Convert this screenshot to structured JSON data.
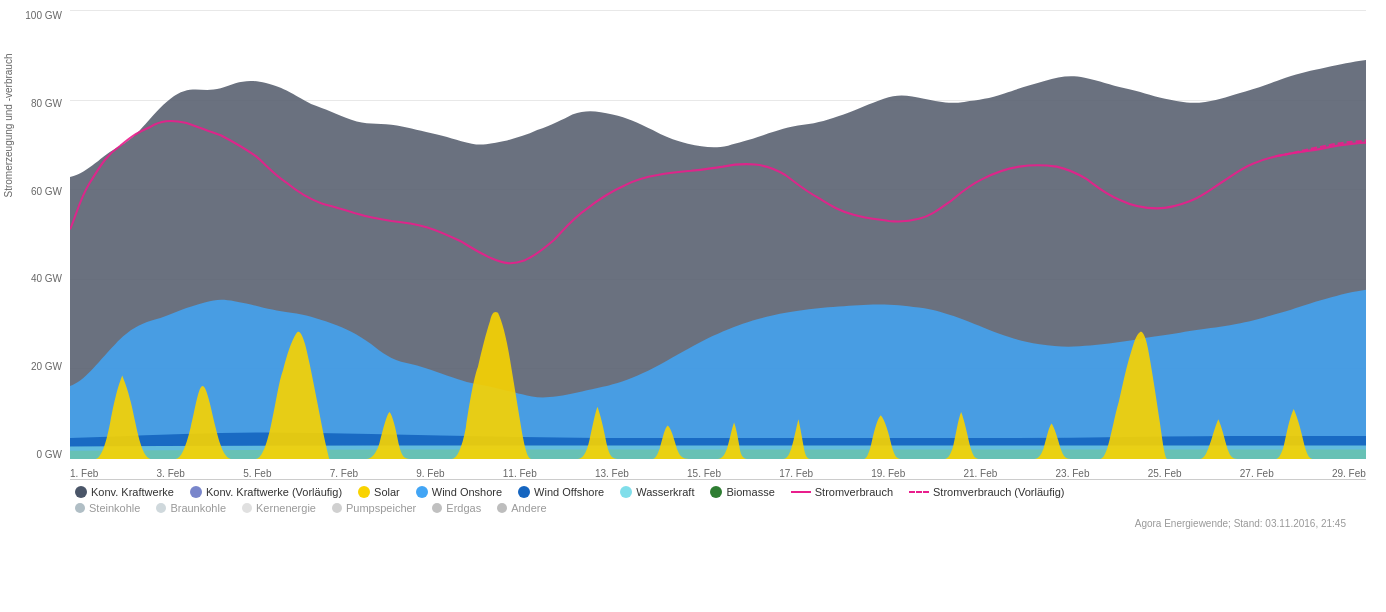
{
  "chart": {
    "title": "Stromerzeugung und -verbrauch",
    "y_axis": {
      "label": "Stromerzeugung und -verbrauch",
      "ticks": [
        "100 GW",
        "80 GW",
        "60 GW",
        "40 GW",
        "20 GW",
        "0 GW"
      ]
    },
    "x_axis": {
      "ticks": [
        "1. Feb",
        "3. Feb",
        "5. Feb",
        "7. Feb",
        "9. Feb",
        "11. Feb",
        "13. Feb",
        "15. Feb",
        "17. Feb",
        "19. Feb",
        "21. Feb",
        "23. Feb",
        "25. Feb",
        "27. Feb",
        "29. Feb"
      ]
    }
  },
  "legend": {
    "row1": [
      {
        "type": "dot",
        "color": "#4a5568",
        "label": "Konv. Kraftwerke"
      },
      {
        "type": "dot",
        "color": "#7986cb",
        "label": "Konv. Kraftwerke (Vorläufig)"
      },
      {
        "type": "dot",
        "color": "#f9d300",
        "label": "Solar"
      },
      {
        "type": "dot",
        "color": "#42a5f5",
        "label": "Wind Onshore"
      },
      {
        "type": "dot",
        "color": "#1565c0",
        "label": "Wind Offshore"
      },
      {
        "type": "dot",
        "color": "#80deea",
        "label": "Wasserkraft"
      },
      {
        "type": "dot",
        "color": "#2e7d32",
        "label": "Biomasse"
      },
      {
        "type": "line",
        "color": "#e91e8c",
        "dashed": false,
        "label": "Stromverbrauch"
      },
      {
        "type": "line",
        "color": "#e91e8c",
        "dashed": true,
        "label": "Stromverbrauch (Vorläufig)"
      }
    ],
    "row2": [
      {
        "type": "dot",
        "color": "#b0bec5",
        "label": "Steinkohle"
      },
      {
        "type": "dot",
        "color": "#cfd8dc",
        "label": "Braunkohle"
      },
      {
        "type": "dot",
        "color": "#e0e0e0",
        "label": "Kernenergie"
      },
      {
        "type": "dot",
        "color": "#d0d0d0",
        "label": "Pumpspeicher"
      },
      {
        "type": "dot",
        "color": "#c0c0c0",
        "label": "Erdgas"
      },
      {
        "type": "dot",
        "color": "#bdbdbd",
        "label": "Andere"
      }
    ]
  },
  "footer": {
    "credit": "Agora Energiewende; Stand: 03.11.2016, 21:45"
  }
}
